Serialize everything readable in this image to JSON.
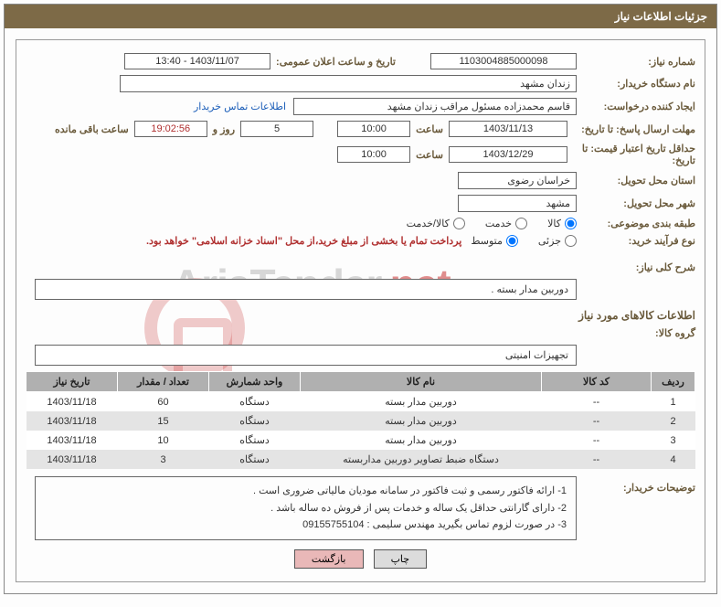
{
  "header": {
    "title": "جزئیات اطلاعات نیاز"
  },
  "labels": {
    "need_no": "شماره نیاز:",
    "announce_dt": "تاریخ و ساعت اعلان عمومی:",
    "buyer_org": "نام دستگاه خریدار:",
    "requester": "ایجاد کننده درخواست:",
    "buyer_contact": "اطلاعات تماس خریدار",
    "reply_deadline": "مهلت ارسال پاسخ: تا تاریخ:",
    "hour": "ساعت",
    "days_and": "روز و",
    "remaining": "ساعت باقی مانده",
    "price_validity": "حداقل تاریخ اعتبار قیمت: تا تاریخ:",
    "province": "استان محل تحویل:",
    "city": "شهر محل تحویل:",
    "subject_class": "طبقه بندی موضوعی:",
    "purchase_type": "نوع فرآیند خرید:",
    "need_summary": "شرح کلی نیاز:",
    "items_section": "اطلاعات کالاهای مورد نیاز",
    "goods_group": "گروه کالا:",
    "buyer_notes": "توضیحات خریدار:"
  },
  "fields": {
    "need_no": "1103004885000098",
    "announce_dt": "1403/11/07 - 13:40",
    "buyer_org": "زندان مشهد",
    "requester": "قاسم محمدزاده مسئول مراقب زندان مشهد",
    "reply_date": "1403/11/13",
    "reply_time": "10:00",
    "remaining_days": "5",
    "remaining_time": "19:02:56",
    "price_validity_date": "1403/12/29",
    "price_validity_time": "10:00",
    "province": "خراسان رضوی",
    "city": "مشهد",
    "need_summary": "دوربین مدار بسته .",
    "goods_group": "تجهیزات امنیتی"
  },
  "radios": {
    "subject": {
      "goods": "کالا",
      "service": "خدمت",
      "goods_service": "کالا/خدمت"
    },
    "purchase": {
      "minor": "جزئی",
      "medium": "متوسط"
    }
  },
  "purchase_note": "پرداخت تمام یا بخشی از مبلغ خرید،از محل \"اسناد خزانه اسلامی\" خواهد بود.",
  "table": {
    "headers": {
      "row": "ردیف",
      "code": "کد کالا",
      "name": "نام کالا",
      "unit": "واحد شمارش",
      "qty": "تعداد / مقدار",
      "need_date": "تاریخ نیاز"
    },
    "rows": [
      {
        "row": "1",
        "code": "--",
        "name": "دوربین مدار بسته",
        "unit": "دستگاه",
        "qty": "60",
        "need_date": "1403/11/18"
      },
      {
        "row": "2",
        "code": "--",
        "name": "دوربین مدار بسته",
        "unit": "دستگاه",
        "qty": "15",
        "need_date": "1403/11/18"
      },
      {
        "row": "3",
        "code": "--",
        "name": "دوربین مدار بسته",
        "unit": "دستگاه",
        "qty": "10",
        "need_date": "1403/11/18"
      },
      {
        "row": "4",
        "code": "--",
        "name": "دستگاه ضبط تصاویر دوربین مداربسته",
        "unit": "دستگاه",
        "qty": "3",
        "need_date": "1403/11/18"
      }
    ]
  },
  "notes": {
    "l1": "1-   ارائه  فاکتور رسمی   و  ثبت   فاکتور  در   سامانه   مودیان  مالیاتی  ضروری   است   .",
    "l2": "2-   دارای  گارانتی   حداقل  یک  ساله  و خدمات پس از فروش   ده ساله باشد  .",
    "l3": "3-   در صورت  لزوم  تماس  بگیرید  مهندس  سلیمی  :  ",
    "phone": "09155755104"
  },
  "buttons": {
    "print": "چاپ",
    "back": "بازگشت"
  },
  "chart_data": {
    "type": "table",
    "title": "اطلاعات کالاهای مورد نیاز",
    "columns": [
      "ردیف",
      "کد کالا",
      "نام کالا",
      "واحد شمارش",
      "تعداد / مقدار",
      "تاریخ نیاز"
    ],
    "rows": [
      [
        1,
        "--",
        "دوربین مدار بسته",
        "دستگاه",
        60,
        "1403/11/18"
      ],
      [
        2,
        "--",
        "دوربین مدار بسته",
        "دستگاه",
        15,
        "1403/11/18"
      ],
      [
        3,
        "--",
        "دوربین مدار بسته",
        "دستگاه",
        10,
        "1403/11/18"
      ],
      [
        4,
        "--",
        "دستگاه ضبط تصاویر دوربین مداربسته",
        "دستگاه",
        3,
        "1403/11/18"
      ]
    ]
  }
}
